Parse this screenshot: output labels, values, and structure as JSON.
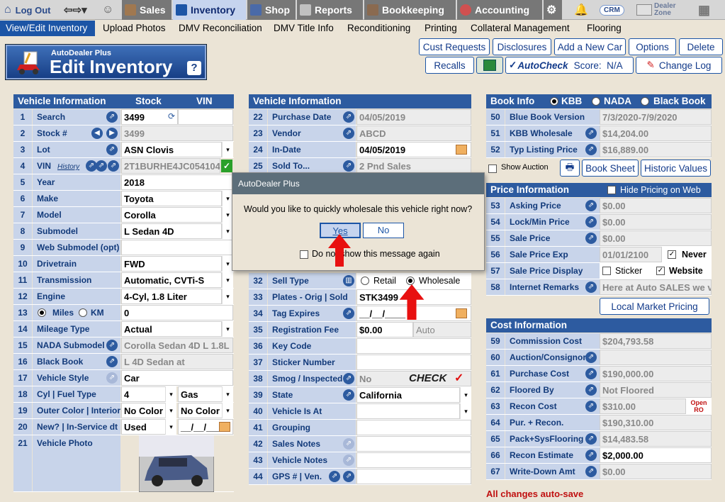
{
  "topnav": {
    "logout": "Log Out",
    "tabs": [
      "Sales",
      "Inventory",
      "Shop",
      "Reports",
      "Bookkeeping",
      "Accounting"
    ],
    "crm": "CRM",
    "dealer_zone": "Dealer Zone"
  },
  "subnav": [
    "View/Edit Inventory",
    "Upload Photos",
    "DMV Reconciliation",
    "DMV Title Info",
    "Reconditioning",
    "Printing",
    "Collateral Management",
    "Flooring"
  ],
  "logo": {
    "small": "AutoDealer Plus",
    "big": "Edit Inventory",
    "help": "?"
  },
  "toolbar": {
    "cust_requests": "Cust Requests",
    "disclosures": "Disclosures",
    "add_car": "Add a New Car",
    "options": "Options",
    "delete": "Delete",
    "recalls": "Recalls",
    "autocheck": "AutoCheck",
    "score": "Score:  N/A",
    "change_log": "Change Log"
  },
  "vehicle_left": {
    "h1": "Vehicle Information",
    "h2": "Stock",
    "h3": "VIN",
    "rows": [
      {
        "n": "1",
        "label": "Search",
        "value": "3499"
      },
      {
        "n": "2",
        "label": "Stock #",
        "value": "3499"
      },
      {
        "n": "3",
        "label": "Lot",
        "value": "ASN Clovis"
      },
      {
        "n": "4",
        "label": "VIN",
        "value": "2T1BURHE4JC054104",
        "extra": "History"
      },
      {
        "n": "5",
        "label": "Year",
        "value": "2018"
      },
      {
        "n": "6",
        "label": "Make",
        "value": "Toyota"
      },
      {
        "n": "7",
        "label": "Model",
        "value": "Corolla"
      },
      {
        "n": "8",
        "label": "Submodel",
        "value": "L Sedan 4D"
      },
      {
        "n": "9",
        "label": "Web Submodel (opt)",
        "value": ""
      },
      {
        "n": "10",
        "label": "Drivetrain",
        "value": "FWD"
      },
      {
        "n": "11",
        "label": "Transmission",
        "value": "Automatic, CVTi-S"
      },
      {
        "n": "12",
        "label": "Engine",
        "value": "4-Cyl, 1.8 Liter"
      },
      {
        "n": "13",
        "label": "Miles",
        "value": "0",
        "extra": "KM"
      },
      {
        "n": "14",
        "label": "Mileage Type",
        "value": "Actual"
      },
      {
        "n": "15",
        "label": "NADA Submodel",
        "value": "Corolla Sedan 4D L 1.8L"
      },
      {
        "n": "16",
        "label": "Black Book",
        "value": "L 4D Sedan at"
      },
      {
        "n": "17",
        "label": "Vehicle Style",
        "value": "Car"
      },
      {
        "n": "18",
        "label": "Cyl | Fuel Type",
        "value": "4",
        "value2": "Gas"
      },
      {
        "n": "19",
        "label": "Outer Color | Interior",
        "value": "No Color",
        "value2": "No Color"
      },
      {
        "n": "20",
        "label": "New? | In-Service dt",
        "value": "Used",
        "value2": "__/__/____"
      },
      {
        "n": "21",
        "label": "Vehicle Photo",
        "value": ""
      }
    ]
  },
  "vehicle_mid": {
    "h1": "Vehicle Information",
    "rows": [
      {
        "n": "22",
        "label": "Purchase Date",
        "value": "04/05/2019"
      },
      {
        "n": "23",
        "label": "Vendor",
        "value": "ABCD"
      },
      {
        "n": "24",
        "label": "In-Date",
        "value": "04/05/2019"
      },
      {
        "n": "25",
        "label": "Sold To...",
        "value": "2 Pnd Sales"
      },
      {
        "n": "32",
        "label": "Sell Type",
        "value": "Retail",
        "value2": "Wholesale"
      },
      {
        "n": "33",
        "label": "Plates - Orig | Sold",
        "value": "STK3499"
      },
      {
        "n": "34",
        "label": "Tag Expires",
        "value": "__/__/____"
      },
      {
        "n": "35",
        "label": "Registration Fee",
        "value": "$0.00",
        "value2": "Auto"
      },
      {
        "n": "36",
        "label": "Key Code",
        "value": ""
      },
      {
        "n": "37",
        "label": "Sticker Number",
        "value": ""
      },
      {
        "n": "38",
        "label": "Smog / Inspected",
        "value": "No",
        "value2": "CHECK"
      },
      {
        "n": "39",
        "label": "State",
        "value": "California"
      },
      {
        "n": "40",
        "label": "Vehicle Is At",
        "value": ""
      },
      {
        "n": "41",
        "label": "Grouping",
        "value": ""
      },
      {
        "n": "42",
        "label": "Sales Notes",
        "value": ""
      },
      {
        "n": "43",
        "label": "Vehicle Notes",
        "value": ""
      },
      {
        "n": "44",
        "label": "GPS # | Ven.",
        "value": ""
      }
    ]
  },
  "book": {
    "h1": "Book Info",
    "kbb": "KBB",
    "nada": "NADA",
    "bb": "Black Book",
    "rows": [
      {
        "n": "50",
        "label": "Blue Book Version",
        "value": "7/3/2020-7/9/2020"
      },
      {
        "n": "51",
        "label": "KBB Wholesale",
        "value": "$14,204.00"
      },
      {
        "n": "52",
        "label": "Typ Listing Price",
        "value": "$16,889.00"
      }
    ],
    "show_auction": "Show Auction",
    "book_sheet": "Book Sheet",
    "historic": "Historic Values"
  },
  "price": {
    "h1": "Price Information",
    "hide": "Hide Pricing on Web",
    "rows": [
      {
        "n": "53",
        "label": "Asking Price",
        "value": "$0.00"
      },
      {
        "n": "54",
        "label": "Lock/Min Price",
        "value": "$0.00"
      },
      {
        "n": "55",
        "label": "Sale Price",
        "value": "$0.00"
      },
      {
        "n": "56",
        "label": "Sale Price Exp",
        "value": "01/01/2100",
        "value2": "Never"
      },
      {
        "n": "57",
        "label": "Sale Price Display",
        "value": "Sticker",
        "value2": "Website"
      },
      {
        "n": "58",
        "label": "Internet Remarks",
        "value": "Here at Auto SALES we v"
      }
    ],
    "local_market": "Local Market Pricing"
  },
  "cost": {
    "h1": "Cost Information",
    "rows": [
      {
        "n": "59",
        "label": "Commission Cost",
        "value": "$204,793.58"
      },
      {
        "n": "60",
        "label": "Auction/Consignor",
        "value": ""
      },
      {
        "n": "61",
        "label": "Purchase Cost",
        "value": "$190,000.00"
      },
      {
        "n": "62",
        "label": "Floored By",
        "value": "Not Floored"
      },
      {
        "n": "63",
        "label": "Recon Cost",
        "value": "$310.00",
        "value2": "Open RO"
      },
      {
        "n": "64",
        "label": "Pur. + Recon.",
        "value": "$190,310.00"
      },
      {
        "n": "65",
        "label": "Pack+SysFlooring",
        "value": "$14,483.58"
      },
      {
        "n": "66",
        "label": "Recon Estimate",
        "value": "$2,000.00"
      },
      {
        "n": "67",
        "label": "Write-Down Amt",
        "value": "$0.00"
      }
    ],
    "autosave": "All changes auto-save"
  },
  "dialog": {
    "title": "AutoDealer Plus",
    "message": "Would you like to quickly wholesale this vehicle right now?",
    "yes": "Yes",
    "no": "No",
    "dont_show": "Do not show this message again"
  }
}
